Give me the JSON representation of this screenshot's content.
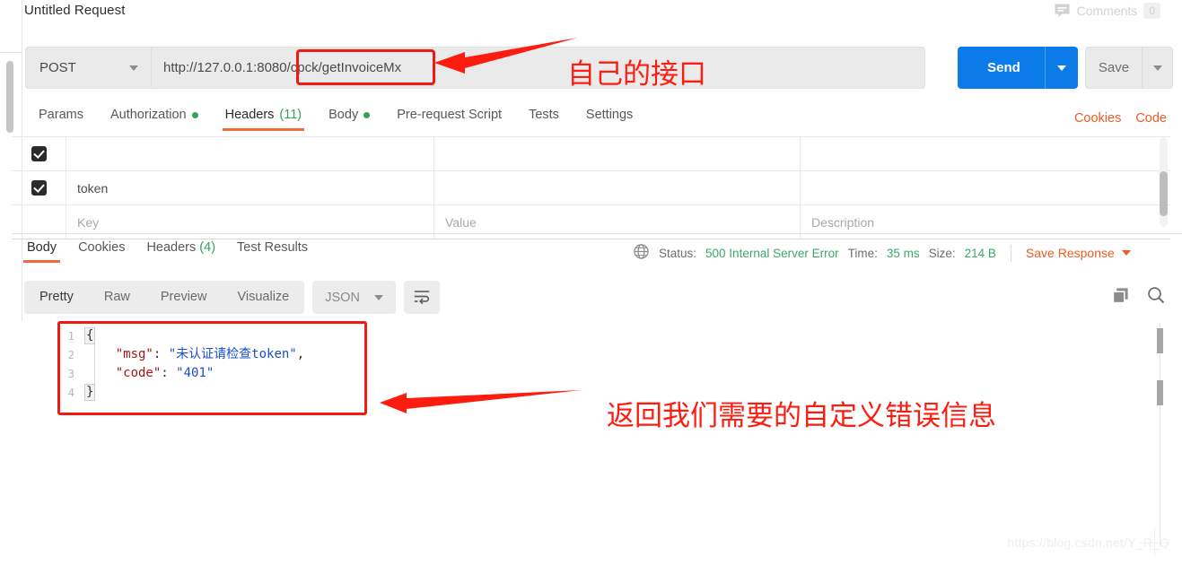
{
  "header": {
    "request_title": "Untitled Request",
    "comments_label": "Comments",
    "comments_count": "0",
    "comments_icon": "comment-icon"
  },
  "url_bar": {
    "method": "POST",
    "method_caret_icon": "chevron-down-icon",
    "url_host": "http://127.0.0.1:8080",
    "url_path": "/cpck/getInvoiceMx",
    "url_full": "http://127.0.0.1:8080/cpck/getInvoiceMx",
    "send_label": "Send",
    "send_caret_icon": "chevron-down-icon",
    "save_label": "Save",
    "save_caret_icon": "chevron-down-icon"
  },
  "request_tabs": [
    {
      "label": "Params",
      "active": false,
      "dot": false,
      "count": ""
    },
    {
      "label": "Authorization",
      "active": false,
      "dot": true,
      "count": ""
    },
    {
      "label": "Headers",
      "active": true,
      "dot": false,
      "count": "(11)"
    },
    {
      "label": "Body",
      "active": false,
      "dot": true,
      "count": ""
    },
    {
      "label": "Pre-request Script",
      "active": false,
      "dot": false,
      "count": ""
    },
    {
      "label": "Tests",
      "active": false,
      "dot": false,
      "count": ""
    },
    {
      "label": "Settings",
      "active": false,
      "dot": false,
      "count": ""
    }
  ],
  "request_tabs_right": {
    "cookies": "Cookies",
    "code": "Code"
  },
  "headers_table": {
    "columns": [
      "Key",
      "Value",
      "Description"
    ],
    "rows": [
      {
        "checked": true,
        "key": "",
        "value": "",
        "description": ""
      },
      {
        "checked": true,
        "key": "token",
        "value": "",
        "description": ""
      }
    ],
    "placeholder_row": {
      "key": "Key",
      "value": "Value",
      "description": "Description"
    }
  },
  "response_tabs": [
    {
      "label": "Body",
      "active": true,
      "count": ""
    },
    {
      "label": "Cookies",
      "active": false,
      "count": ""
    },
    {
      "label": "Headers",
      "active": false,
      "count": "(4)"
    },
    {
      "label": "Test Results",
      "active": false,
      "count": ""
    }
  ],
  "response_meta": {
    "globe_icon": "globe-icon",
    "status_label": "Status:",
    "status_value": "500 Internal Server Error",
    "time_label": "Time:",
    "time_value": "35 ms",
    "size_label": "Size:",
    "size_value": "214 B",
    "save_response_label": "Save Response",
    "save_response_caret_icon": "chevron-down-icon"
  },
  "format_bar": {
    "views": [
      {
        "label": "Pretty",
        "active": true
      },
      {
        "label": "Raw",
        "active": false
      },
      {
        "label": "Preview",
        "active": false
      },
      {
        "label": "Visualize",
        "active": false
      }
    ],
    "language": "JSON",
    "language_caret_icon": "chevron-down-icon",
    "wrap_icon": "word-wrap-icon",
    "copy_icon": "copy-icon",
    "search_icon": "search-icon"
  },
  "response_body": {
    "line_numbers": [
      "1",
      "2",
      "3",
      "4"
    ],
    "raw": "{\n    \"msg\": \"未认证请检查token\",\n    \"code\": \"401\"\n}",
    "lines": [
      {
        "open_brace": "{"
      },
      {
        "key": "\"msg\"",
        "colon": ": ",
        "value": "\"未认证请检查token\"",
        "comma": ","
      },
      {
        "key": "\"code\"",
        "colon": ": ",
        "value": "\"401\"",
        "comma": ""
      },
      {
        "close_brace": "}"
      }
    ],
    "parsed": {
      "msg": "未认证请检查token",
      "code": "401"
    }
  },
  "annotations": [
    {
      "id": "url-annotation",
      "text": "自己的接口",
      "arrow": "arrow-left",
      "color": "#fc1d10"
    },
    {
      "id": "body-annotation",
      "text": "返回我们需要的自定义错误信息",
      "arrow": "arrow-left",
      "color": "#fc1d10"
    }
  ],
  "watermark": {
    "text": "https://blog.csdn.net/Y_R_Q"
  },
  "colors": {
    "accent_orange": "#f26b3a",
    "link_orange": "#ef5b25",
    "send_blue": "#0b7bea",
    "status_green": "#3ca76a",
    "annotation_red": "#fc1d10"
  }
}
